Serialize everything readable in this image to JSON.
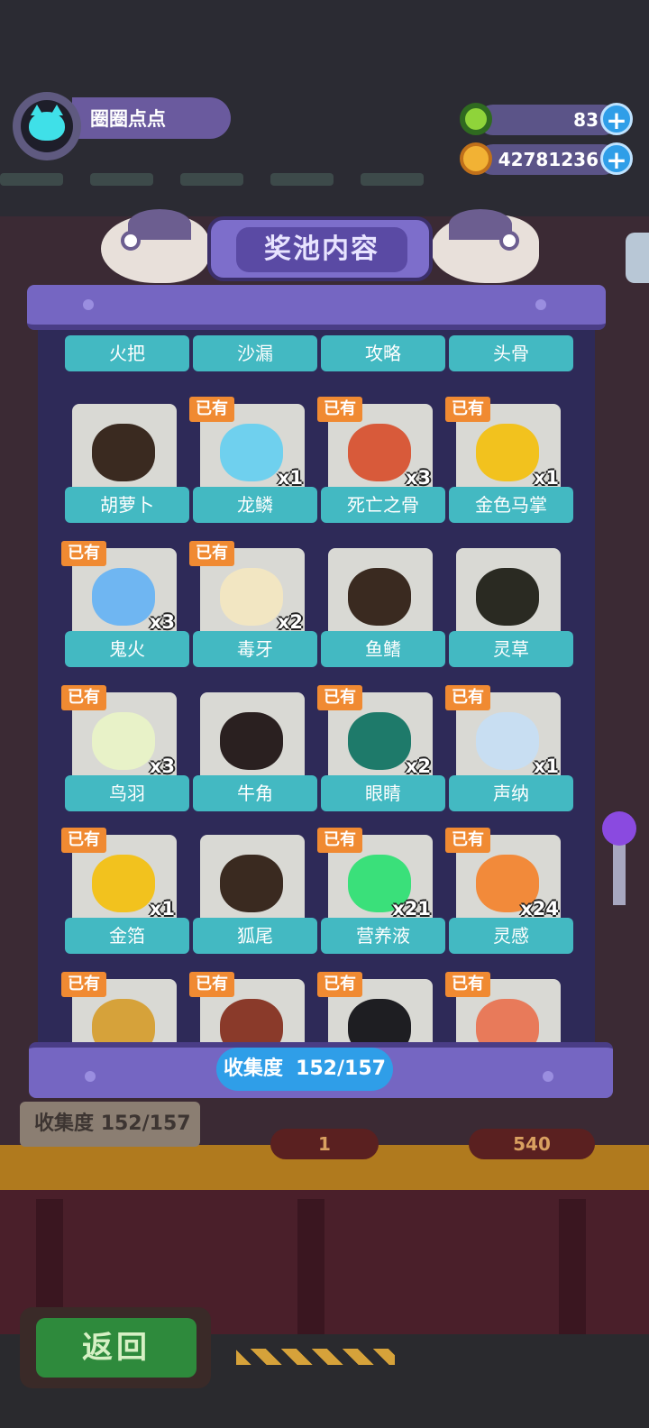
{
  "player": {
    "name": "圈圈点点"
  },
  "currencies": [
    {
      "icon": "green-donut-icon",
      "value": "83",
      "color": "#8fd43a"
    },
    {
      "icon": "planet-coin-icon",
      "value": "42781236",
      "color": "#f2b234"
    }
  ],
  "panel": {
    "title": "奖池内容",
    "top_labels": [
      "火把",
      "沙漏",
      "攻略",
      "头骨"
    ],
    "owned_badge": "已有",
    "items": [
      {
        "name": "胡萝卜",
        "owned": false,
        "qty": "",
        "icon": "carrot-icon",
        "color": "#3a2a20"
      },
      {
        "name": "龙鳞",
        "owned": true,
        "qty": "x1",
        "icon": "dragon-scale-icon",
        "color": "#6fd0ee"
      },
      {
        "name": "死亡之骨",
        "owned": true,
        "qty": "x3",
        "icon": "bone-icon",
        "color": "#d85a3a"
      },
      {
        "name": "金色马掌",
        "owned": true,
        "qty": "x1",
        "icon": "horseshoe-icon",
        "color": "#f2c21e"
      },
      {
        "name": "鬼火",
        "owned": true,
        "qty": "x3",
        "icon": "ghost-fire-icon",
        "color": "#6fb6f2"
      },
      {
        "name": "毒牙",
        "owned": true,
        "qty": "x2",
        "icon": "fang-icon",
        "color": "#f2e6c2"
      },
      {
        "name": "鱼鳍",
        "owned": false,
        "qty": "",
        "icon": "fish-fin-icon",
        "color": "#3a2a20"
      },
      {
        "name": "灵草",
        "owned": false,
        "qty": "",
        "icon": "spirit-herb-icon",
        "color": "#2a2a22"
      },
      {
        "name": "鸟羽",
        "owned": true,
        "qty": "x3",
        "icon": "feather-icon",
        "color": "#e8f2c8"
      },
      {
        "name": "牛角",
        "owned": false,
        "qty": "",
        "icon": "ox-horn-icon",
        "color": "#2a2020"
      },
      {
        "name": "眼睛",
        "owned": true,
        "qty": "x2",
        "icon": "eye-icon",
        "color": "#1e7a6a"
      },
      {
        "name": "声纳",
        "owned": true,
        "qty": "x1",
        "icon": "sonar-icon",
        "color": "#c8def2"
      },
      {
        "name": "金箔",
        "owned": true,
        "qty": "x1",
        "icon": "gold-leaf-icon",
        "color": "#f2c21e"
      },
      {
        "name": "狐尾",
        "owned": false,
        "qty": "",
        "icon": "fox-tail-icon",
        "color": "#3a2a20"
      },
      {
        "name": "营养液",
        "owned": true,
        "qty": "x21",
        "icon": "nutrient-potion-icon",
        "color": "#3ae07a"
      },
      {
        "name": "灵感",
        "owned": true,
        "qty": "x24",
        "icon": "inspiration-icon",
        "color": "#f28a3a"
      }
    ],
    "partial_row_icons": [
      {
        "icon": "boot-icon",
        "color": "#d6a23a"
      },
      {
        "icon": "bottle-icon",
        "color": "#8a3a2a"
      },
      {
        "icon": "ink-bottle-icon",
        "color": "#1e1e22"
      },
      {
        "icon": "fingerprint-icon",
        "color": "#e87a5a"
      }
    ],
    "progress": {
      "label": "收集度",
      "value": "152/157"
    }
  },
  "background": {
    "collect_label": "收集度",
    "collect_value": "152/157",
    "cost_left": "1",
    "cost_right": "540"
  },
  "back_button": "返回"
}
